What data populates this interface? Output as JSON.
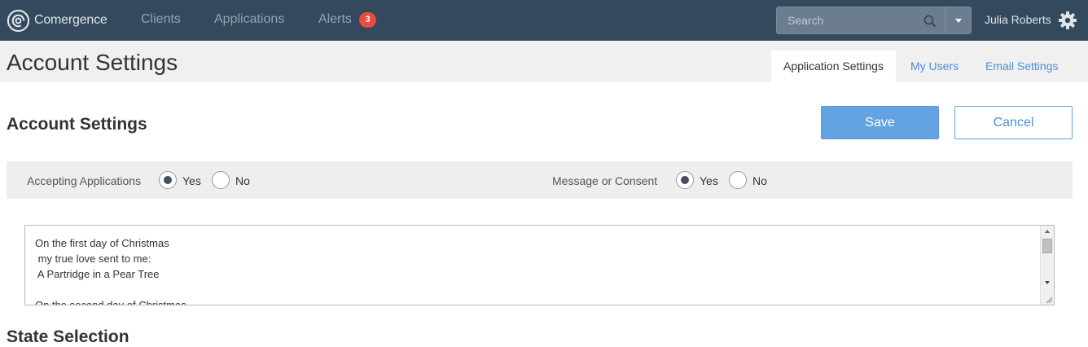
{
  "nav": {
    "brand": "Comergence",
    "links": [
      "Clients",
      "Applications",
      "Alerts"
    ],
    "alerts_count": "3",
    "search_placeholder": "Search",
    "user_name": "Julia Roberts"
  },
  "header": {
    "title": "Account Settings",
    "tabs": [
      "Application Settings",
      "My Users",
      "Email Settings"
    ],
    "active_tab": "Application Settings"
  },
  "main": {
    "section_title": "Account Settings",
    "save_label": "Save",
    "cancel_label": "Cancel",
    "options": {
      "accepting_label": "Accepting Applications",
      "accepting_value": "Yes",
      "consent_label": "Message or Consent",
      "consent_value": "Yes",
      "yes_label": "Yes",
      "no_label": "No"
    },
    "message_text": "On the first day of Christmas\n my true love sent to me:\n A Partridge in a Pear Tree\n\nOn the second day of Christmas",
    "next_section_title": "State Selection"
  },
  "colors": {
    "navbar": "#34495e",
    "accent": "#64a3e1",
    "badge": "#e74c3c"
  },
  "icons": [
    "comergence-logo-icon",
    "search-icon",
    "chevron-down-icon",
    "gear-icon"
  ]
}
